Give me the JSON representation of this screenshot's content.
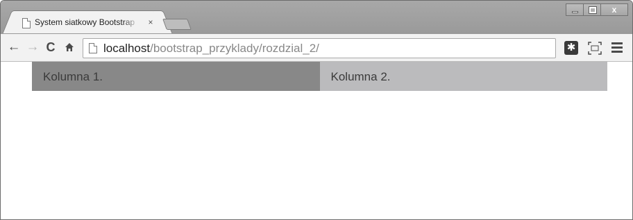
{
  "browser": {
    "tab": {
      "title": "System siatkowy Bootstrap",
      "close_label": "×"
    },
    "window_controls": {
      "minimize_icon": "minimize-icon",
      "maximize_icon": "maximize-icon",
      "close_label": "x"
    },
    "toolbar": {
      "back_label": "←",
      "forward_label": "→",
      "reload_label": "C",
      "home_icon": "home-icon",
      "url_host": "localhost",
      "url_path": "/bootstrap_przyklady/rozdzial_2/",
      "extension_label": "✱",
      "cast_icon": "cast-icon",
      "menu_icon": "hamburger-menu-icon"
    }
  },
  "page": {
    "columns": [
      {
        "label": "Kolumna 1."
      },
      {
        "label": "Kolumna 2."
      }
    ]
  },
  "colors": {
    "column_1_bg": "#888888",
    "column_2_bg": "#bbbbbd",
    "chrome_frame": "#a0a0a0"
  }
}
